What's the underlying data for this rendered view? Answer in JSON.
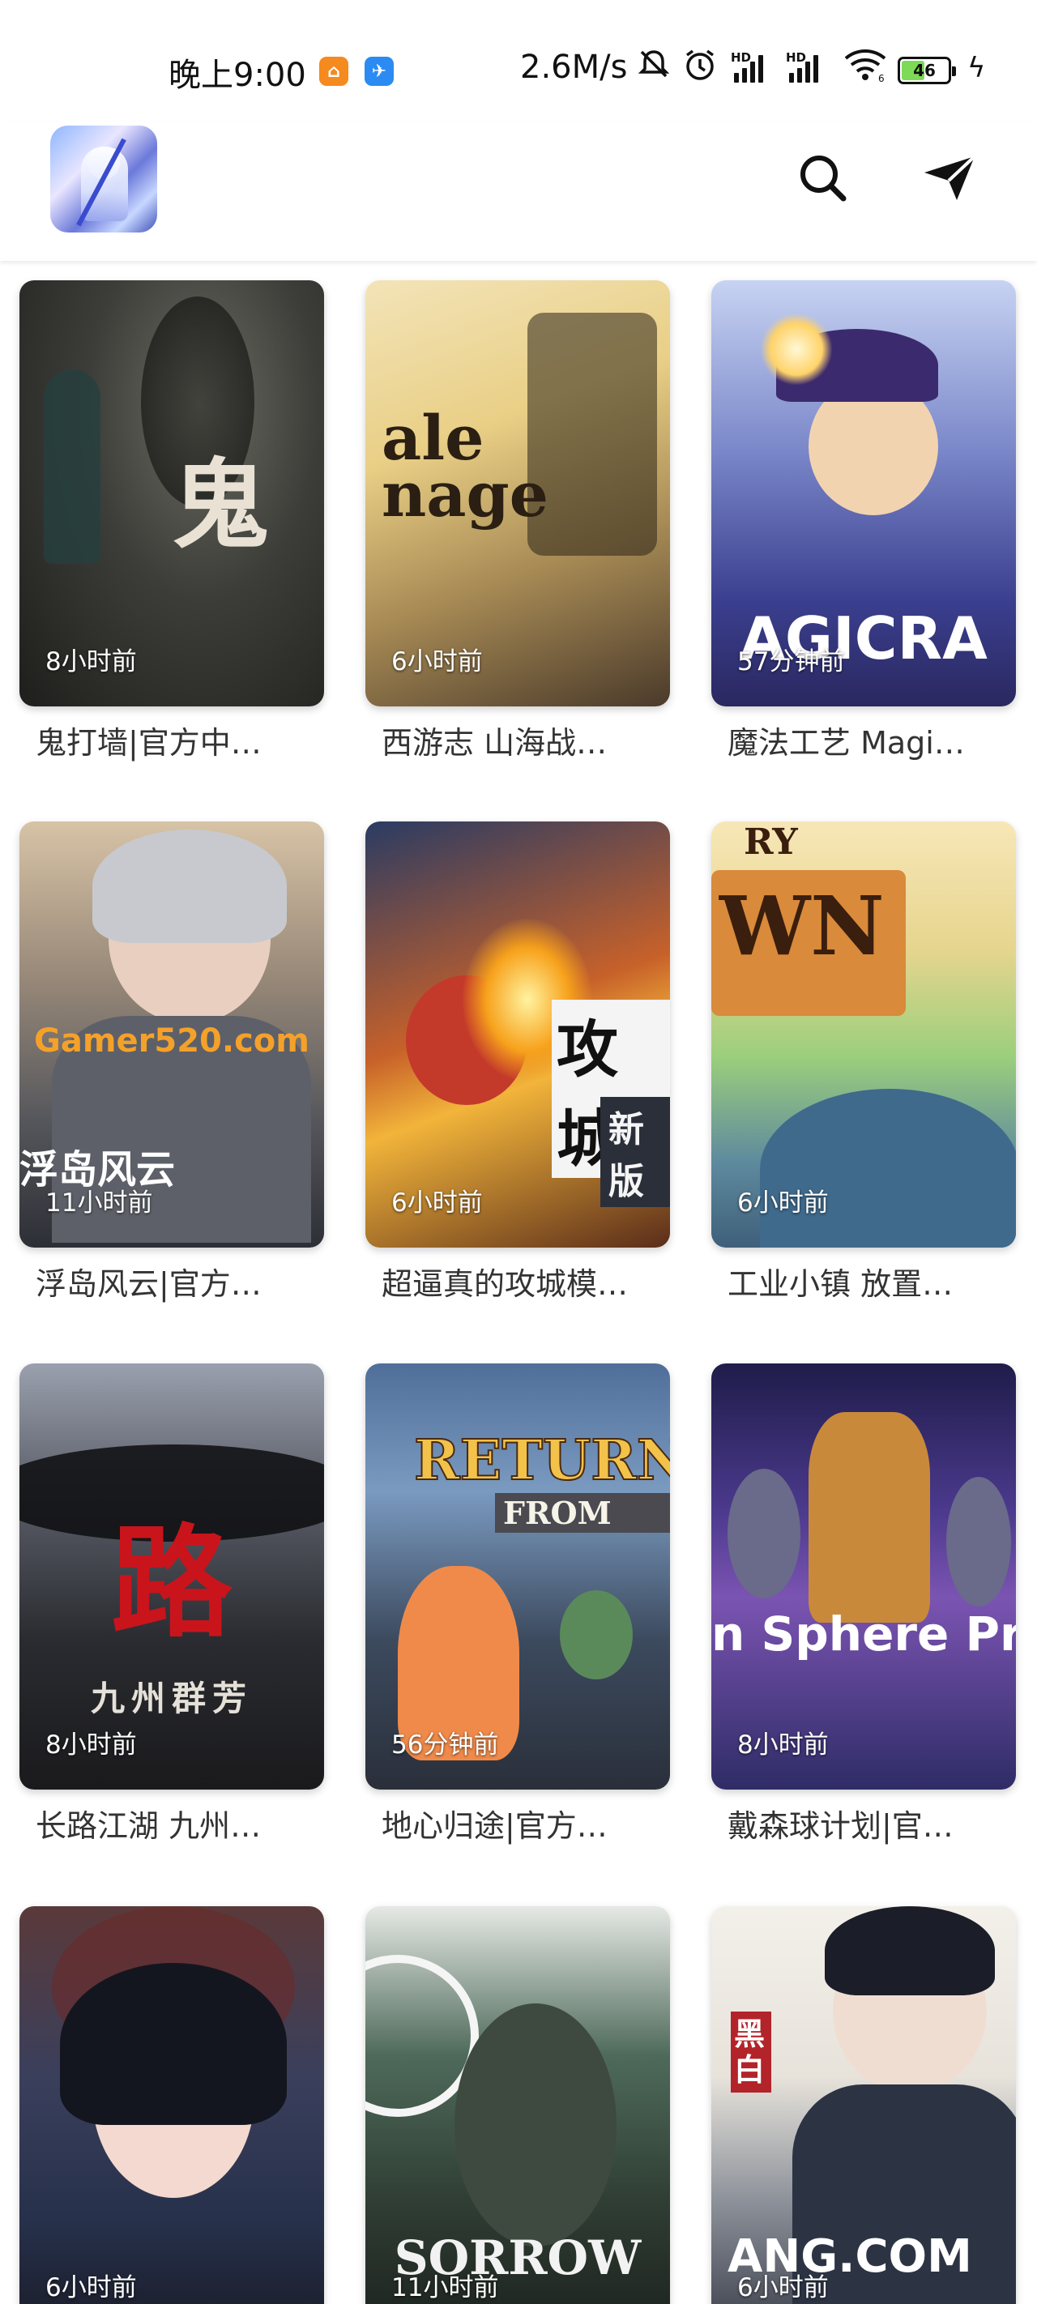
{
  "status_bar": {
    "time": "晚上9:00",
    "network_speed": "2.6M/s",
    "battery_level": "46",
    "icons": [
      "orange-app-icon",
      "blue-app-icon",
      "mute-icon",
      "alarm-icon",
      "signal-hd-1-icon",
      "signal-hd-2-icon",
      "wifi-icon",
      "battery-icon",
      "charging-icon"
    ],
    "signal_labels": [
      "HD",
      "HD"
    ],
    "wifi_badge": "6"
  },
  "header": {
    "search_icon": "search-icon",
    "send_icon": "send-icon",
    "logo_icon": "app-logo"
  },
  "cards": [
    {
      "time": "8小时前",
      "title": "鬼打墙|官方中…",
      "art_text": "鬼"
    },
    {
      "time": "6小时前",
      "title": "西游志 山海战…",
      "art_text": "ale\nnage"
    },
    {
      "time": "57分钟前",
      "title": "魔法工艺 Magi…",
      "art_text": "AGICRA"
    },
    {
      "time": "11小时前",
      "title": "浮岛风云|官方…",
      "art_text": "Gamer520.com",
      "art_text_2": "浮岛风云"
    },
    {
      "time": "6小时前",
      "title": "超逼真的攻城模…",
      "art_text": "攻城",
      "art_text_2": "新版"
    },
    {
      "time": "6小时前",
      "title": "工业小镇 放置…",
      "art_text": "WN",
      "art_text_2": "RY"
    },
    {
      "time": "8小时前",
      "title": "长路江湖 九州…",
      "art_text": "路",
      "art_text_2": "九州群芳"
    },
    {
      "time": "56分钟前",
      "title": "地心归途|官方…",
      "art_text": "RETURN",
      "art_text_2": "FROM"
    },
    {
      "time": "8小时前",
      "title": "戴森球计划|官…",
      "art_text": "n Sphere Proj"
    },
    {
      "time": "6小时前",
      "title": "",
      "art_text": ""
    },
    {
      "time": "11小时前",
      "title": "",
      "art_text": "SORROW"
    },
    {
      "time": "6小时前",
      "title": "",
      "art_text": "ANG.COM",
      "art_text_2": "黑白"
    }
  ]
}
